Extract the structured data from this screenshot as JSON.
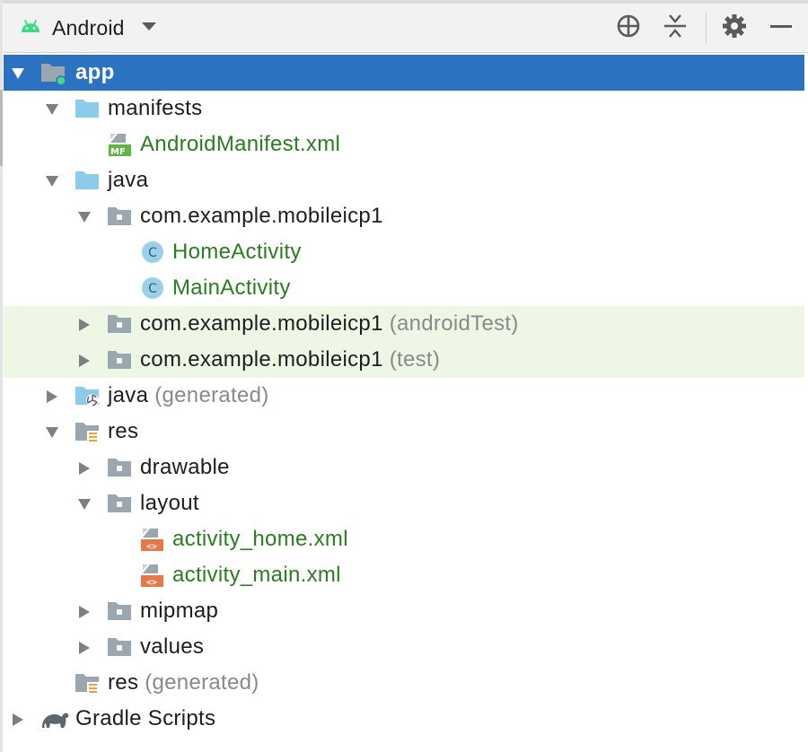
{
  "toolbar": {
    "view_label": "Android",
    "buttons": [
      "locate-icon",
      "collapse-all-icon",
      "gear-icon",
      "minimize-icon"
    ]
  },
  "tree": [
    {
      "name": "app",
      "suffix": "",
      "state": "expanded",
      "icon": "module-folder-icon",
      "selected": true
    },
    {
      "name": "manifests",
      "suffix": "",
      "state": "expanded",
      "icon": "folder-icon"
    },
    {
      "name": "AndroidManifest.xml",
      "suffix": "",
      "state": "leaf",
      "icon": "manifest-file-icon",
      "green": true
    },
    {
      "name": "java",
      "suffix": "",
      "state": "expanded",
      "icon": "folder-icon"
    },
    {
      "name": "com.example.mobileicp1",
      "suffix": "",
      "state": "expanded",
      "icon": "package-icon"
    },
    {
      "name": "HomeActivity",
      "suffix": "",
      "state": "leaf",
      "icon": "class-icon",
      "green": true
    },
    {
      "name": "MainActivity",
      "suffix": "",
      "state": "leaf",
      "icon": "class-icon",
      "green": true
    },
    {
      "name": "com.example.mobileicp1",
      "suffix": "(androidTest)",
      "state": "collapsed",
      "icon": "package-icon"
    },
    {
      "name": "com.example.mobileicp1",
      "suffix": "(test)",
      "state": "collapsed",
      "icon": "package-icon"
    },
    {
      "name": "java",
      "suffix": "(generated)",
      "state": "collapsed",
      "icon": "generated-folder-icon"
    },
    {
      "name": "res",
      "suffix": "",
      "state": "expanded",
      "icon": "resource-folder-icon"
    },
    {
      "name": "drawable",
      "suffix": "",
      "state": "collapsed",
      "icon": "package-icon"
    },
    {
      "name": "layout",
      "suffix": "",
      "state": "expanded",
      "icon": "package-icon"
    },
    {
      "name": "activity_home.xml",
      "suffix": "",
      "state": "leaf",
      "icon": "layout-file-icon",
      "green": true
    },
    {
      "name": "activity_main.xml",
      "suffix": "",
      "state": "leaf",
      "icon": "layout-file-icon",
      "green": true
    },
    {
      "name": "mipmap",
      "suffix": "",
      "state": "collapsed",
      "icon": "package-icon"
    },
    {
      "name": "values",
      "suffix": "",
      "state": "collapsed",
      "icon": "package-icon"
    },
    {
      "name": "res",
      "suffix": "(generated)",
      "state": "leaf",
      "icon": "resource-folder-icon"
    },
    {
      "name": "Gradle Scripts",
      "suffix": "",
      "state": "collapsed",
      "icon": "gradle-icon"
    }
  ],
  "colors": {
    "selection": "#2b72c0",
    "test_tint": "#eef7e6",
    "source_green": "#2a7d20",
    "folder_blue": "#8ccbea",
    "android_green": "#3ddc84"
  }
}
